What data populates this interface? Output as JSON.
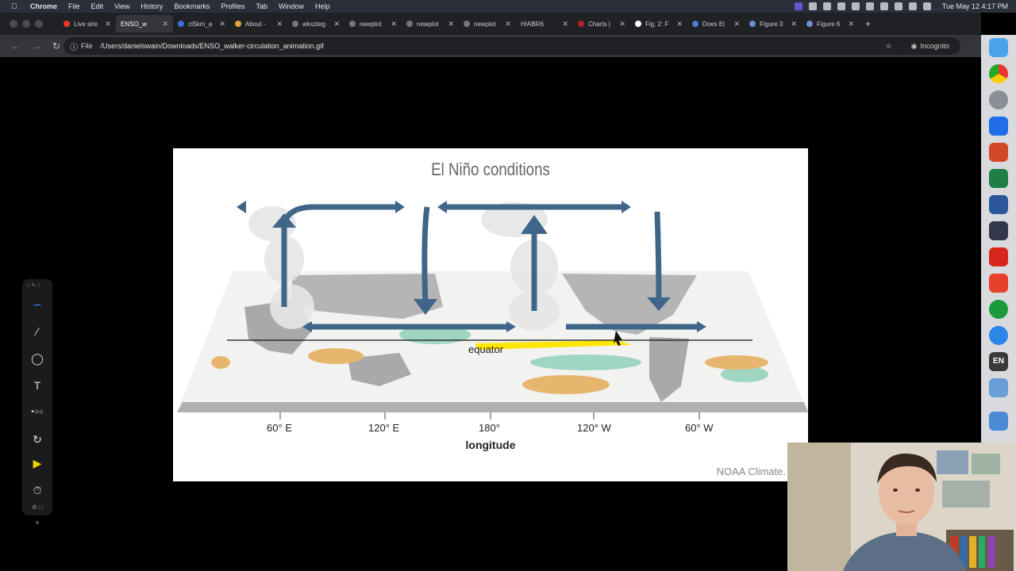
{
  "menubar": {
    "app": "Chrome",
    "items": [
      "File",
      "Edit",
      "View",
      "History",
      "Bookmarks",
      "Profiles",
      "Tab",
      "Window",
      "Help"
    ],
    "clock": "Tue May 12  4:17 PM"
  },
  "tabs": [
    {
      "label": "Live stre",
      "active": false
    },
    {
      "label": "ENSO_w",
      "active": true
    },
    {
      "label": "ct5km_a",
      "active": false
    },
    {
      "label": "About -",
      "active": false
    },
    {
      "label": "wkxzteg",
      "active": false
    },
    {
      "label": "newplot",
      "active": false
    },
    {
      "label": "newplot",
      "active": false
    },
    {
      "label": "newplot",
      "active": false
    },
    {
      "label": "HIABR6",
      "active": false
    },
    {
      "label": "Charts |",
      "active": false
    },
    {
      "label": "Fig. 2: F",
      "active": false
    },
    {
      "label": "Does El",
      "active": false
    },
    {
      "label": "Figure 3",
      "active": false
    },
    {
      "label": "Figure 6",
      "active": false
    }
  ],
  "toolbar": {
    "scheme_chip": "File",
    "url": "/Users/danielswain/Downloads/ENSO_walker-circulation_animation.gif",
    "incognito_label": "Incognito"
  },
  "dock": {
    "en_label": "EN"
  },
  "figure": {
    "title": "El Niño conditions",
    "equator_label": "equator",
    "tick_labels": [
      "60° E",
      "120° E",
      "180°",
      "120° W",
      "60° W"
    ],
    "xlabel": "longitude",
    "credit": "NOAA Climate."
  },
  "colors": {
    "arrow": "#3f6688",
    "warm": "#e7b66e",
    "cool": "#9fd6c2",
    "land": "#a9a9a9",
    "cursor_highlight": "#ffe600"
  }
}
